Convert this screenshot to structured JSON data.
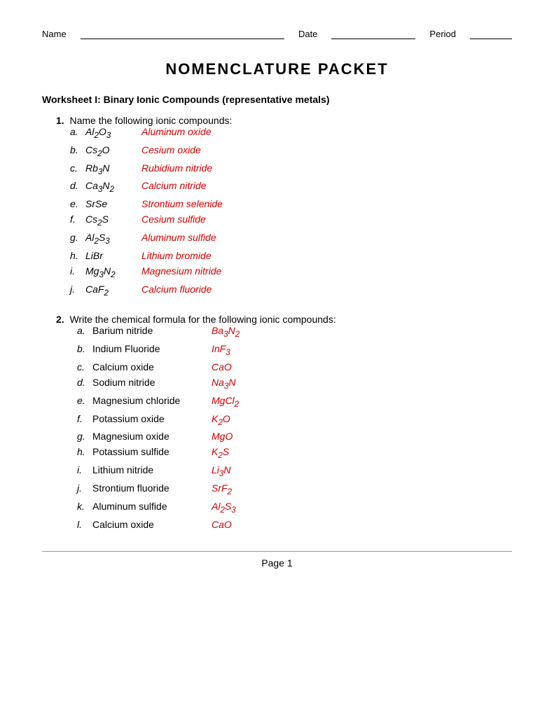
{
  "header": {
    "name_label": "Name",
    "date_label": "Date",
    "period_label": "Period"
  },
  "title": "NOMENCLATURE PACKET",
  "worksheet1": {
    "title": "Worksheet I: Binary Ionic Compounds (representative metals)",
    "q1": {
      "text": "Name the following ionic compounds:",
      "items": [
        {
          "label": "a.",
          "formula_html": "Al<sub>2</sub>O<sub>3</sub>",
          "answer": "Aluminum oxide"
        },
        {
          "label": "b.",
          "formula_html": "Cs<sub>2</sub>O",
          "answer": "Cesium oxide"
        },
        {
          "label": "c.",
          "formula_html": "Rb<sub>3</sub>N",
          "answer": "Rubidium nitride"
        },
        {
          "label": "d.",
          "formula_html": "Ca<sub>3</sub>N<sub>2</sub>",
          "answer": "Calcium nitride"
        },
        {
          "label": "e.",
          "formula_html": "SrSe",
          "answer": "Strontium selenide"
        },
        {
          "label": "f.",
          "formula_html": "Cs<sub>2</sub>S",
          "answer": "Cesium sulfide"
        },
        {
          "label": "g.",
          "formula_html": "Al<sub>2</sub>S<sub>3</sub>",
          "answer": "Aluminum sulfide"
        },
        {
          "label": "h.",
          "formula_html": "LiBr",
          "answer": "Lithium bromide"
        },
        {
          "label": "i.",
          "formula_html": "Mg<sub>3</sub>N<sub>2</sub>",
          "answer": "Magnesium nitride"
        },
        {
          "label": "j.",
          "formula_html": "CaF<sub>2</sub>",
          "answer": "Calcium fluoride"
        }
      ]
    },
    "q2": {
      "text": "Write the chemical formula for the following ionic compounds:",
      "items": [
        {
          "label": "a.",
          "compound": "Barium nitride",
          "answer_html": "Ba<sub>3</sub>N<sub>2</sub>"
        },
        {
          "label": "b.",
          "compound": "Indium Fluoride",
          "answer_html": "InF<sub>3</sub>"
        },
        {
          "label": "c.",
          "compound": "Calcium oxide",
          "answer_html": "CaO"
        },
        {
          "label": "d.",
          "compound": "Sodium nitride",
          "answer_html": "Na<sub>3</sub>N"
        },
        {
          "label": "e.",
          "compound": "Magnesium chloride",
          "answer_html": "MgCl<sub>2</sub>"
        },
        {
          "label": "f.",
          "compound": "Potassium oxide",
          "answer_html": "K<sub>2</sub>O"
        },
        {
          "label": "g.",
          "compound": "Magnesium oxide",
          "answer_html": "MgO"
        },
        {
          "label": "h.",
          "compound": "Potassium sulfide",
          "answer_html": "K<sub>2</sub>S"
        },
        {
          "label": "i.",
          "compound": "Lithium nitride",
          "answer_html": "Li<sub>3</sub>N"
        },
        {
          "label": "j.",
          "compound": "Strontium fluoride",
          "answer_html": "SrF<sub>2</sub>"
        },
        {
          "label": "k.",
          "compound": "Aluminum sulfide",
          "answer_html": "Al<sub>2</sub>S<sub>3</sub>"
        },
        {
          "label": "l.",
          "compound": "Calcium oxide",
          "answer_html": "CaO"
        }
      ]
    }
  },
  "footer": {
    "page_label": "Page 1"
  }
}
